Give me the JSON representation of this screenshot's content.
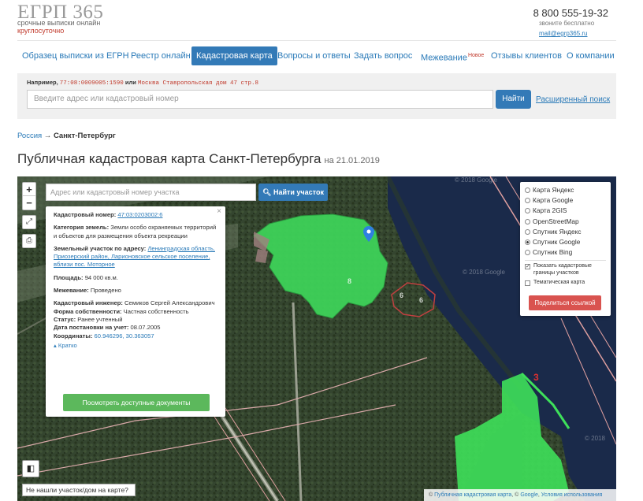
{
  "brand": {
    "logo": "ЕГРП 365",
    "tagline": "срочные выписки онлайн",
    "tagline2": "круглосуточно"
  },
  "contact": {
    "phone": "8 800 555-19-32",
    "phone_note": "звоните бесплатно",
    "email": "mail@egrp365.ru"
  },
  "nav": {
    "items": [
      "Образец выписки из ЕГРН",
      "Реестр онлайн",
      "Кадастровая карта",
      "Вопросы и ответы",
      "Задать вопрос",
      "Межевание",
      "Отзывы клиентов",
      "О компании"
    ],
    "new_badge": "Новое"
  },
  "search": {
    "example_prefix": "Например,",
    "example_code": "77:08:0009005:1590",
    "example_or": "или",
    "example_addr": "Москва Ставропольская дом 47 стр.8",
    "placeholder": "Введите адрес или кадастровый номер",
    "button": "Найти",
    "advanced": "Расширенный поиск"
  },
  "breadcrumb": {
    "root": "Россия",
    "arrow": "→",
    "current": "Санкт-Петербург"
  },
  "page": {
    "title": "Публичная кадастровая карта Санкт-Петербурга",
    "date": "на 21.01.2019"
  },
  "map": {
    "search_placeholder": "Адрес или кадастровый номер участка",
    "search_button": "Найти участок",
    "zoom_in": "+",
    "zoom_out": "−",
    "info": {
      "cad_label": "Кадастровый номер:",
      "cad_value": "47:03:0203002:6",
      "land_cat_label": "Категория земель:",
      "land_cat_value": "Земли особо охраняемых территорий и объектов для размещения объекта рекреации",
      "address_label": "Земельный участок по адресу:",
      "address_value": "Ленинградская область, Приозерский район, Ларионовское сельское поселение, вблизи пос. Моторное",
      "area_label": "Площадь:",
      "area_value": "94 000 кв.м.",
      "survey_label": "Межевание:",
      "survey_value": "Проведено",
      "engineer_label": "Кадастровый инженер:",
      "engineer_value": "Семиков Сергей Александрович",
      "ownership_label": "Форма собственности:",
      "ownership_value": "Частная собственность",
      "status_label": "Статус:",
      "status_value": "Ранее учтенный",
      "date_label": "Дата постановки на учет:",
      "date_value": "08.07.2005",
      "coords_label": "Координаты:",
      "coords_value": "60.946296, 30.363057",
      "collapse": "Кратко",
      "docs_button": "Посмотреть доступные документы",
      "close": "×"
    },
    "layers": {
      "options": [
        "Карта Яндекс",
        "Карта Google",
        "Карта 2GIS",
        "OpenStreetMap",
        "Спутник Яндекс",
        "Спутник Google",
        "Спутник Bing"
      ],
      "selected": "Спутник Google",
      "show_borders": "Показать кадастровые границы участков",
      "thematic": "Тематическая карта",
      "share": "Поделиться ссылкой"
    },
    "not_found": "Не нашли участок/дом на карте?",
    "attribution": {
      "copy": "©",
      "cad_map": "Публичная кадастровая карта",
      "sep": ", ©",
      "google": "Google",
      "terms": "Условия использования"
    },
    "plot_labels": [
      "8",
      "6",
      "6",
      "3"
    ],
    "watermarks": [
      "© 2018 Google",
      "© 2018 Google",
      "© 2018"
    ]
  }
}
